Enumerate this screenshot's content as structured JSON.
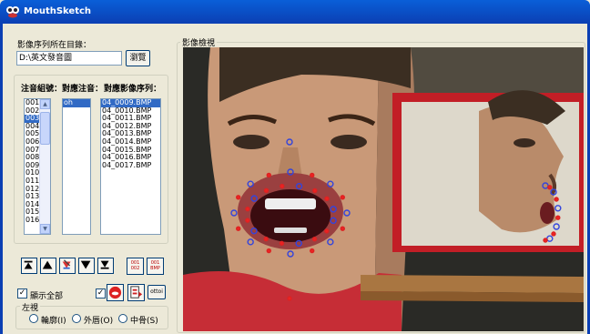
{
  "window": {
    "title": "MouthSketch"
  },
  "path": {
    "label": "影像序列所在目錄：",
    "value": "D:\\英文發音圖",
    "browse_label": "瀏覽"
  },
  "preview": {
    "label": "影像檢視"
  },
  "headers": {
    "phoneme_group": "注音組號：",
    "phoneme": "對應注音：",
    "image_seq": "對應影像序列："
  },
  "group_list": [
    "001",
    "002",
    "003",
    "004",
    "005",
    "006",
    "007",
    "008",
    "009",
    "010",
    "011",
    "012",
    "013",
    "014",
    "015",
    "016"
  ],
  "group_selected": 2,
  "phoneme_list": [
    "oh"
  ],
  "image_list": [
    "04_0009.BMP",
    "04_0010.BMP",
    "04_0011.BMP",
    "04_0012.BMP",
    "04_0013.BMP",
    "04_0014.BMP",
    "04_0015.BMP",
    "04_0016.BMP",
    "04_0017.BMP"
  ],
  "image_selected": 0,
  "toolbar": {
    "btn_a": "001\n002",
    "btn_b": "001\nBMP",
    "show_all_label": "顯示全部",
    "show_all_checked": true,
    "check2_checked": true,
    "otto_label": "ottoi"
  },
  "side": {
    "label": "左視",
    "options": [
      "輪廓(I)",
      "外唇(O)",
      "中骨(S)"
    ]
  }
}
